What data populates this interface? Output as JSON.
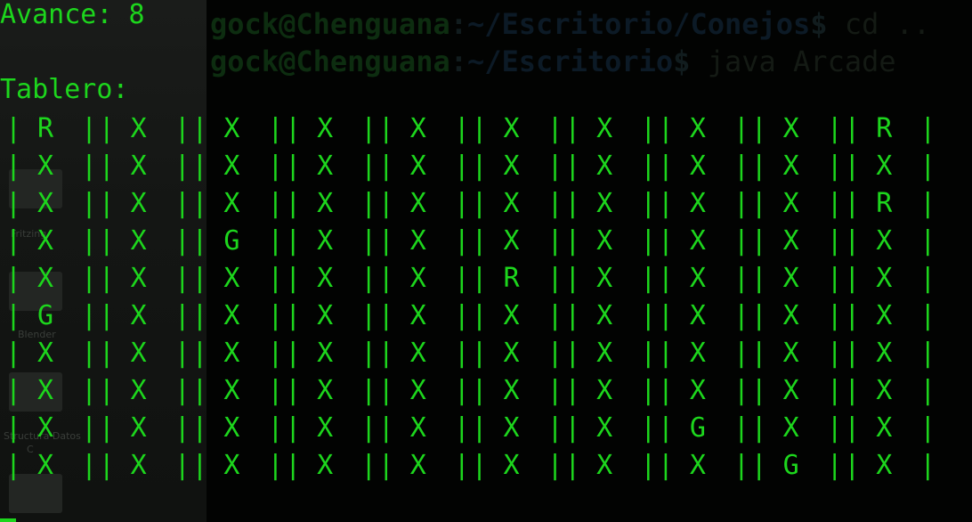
{
  "desktop": {
    "labels": [
      "Fritzing",
      "Blender",
      "Structura Datos",
      "C"
    ]
  },
  "background_terminal": {
    "line1": {
      "user": "gock@Chenguana",
      "sep": ":",
      "path": "~/Escritorio/Conejos",
      "prompt": "$",
      "cmd": " cd .."
    },
    "line2": {
      "user": "gock@Chenguana",
      "sep": ":",
      "path": "~/Escritorio",
      "prompt": "$",
      "cmd": " java Arcade"
    }
  },
  "terminal": {
    "avance_text": "Avance: 8",
    "tablero_text": "Tablero:",
    "separator": "|",
    "board": [
      [
        "R",
        "X",
        "X",
        "X",
        "X",
        "X",
        "X",
        "X",
        "X",
        "R"
      ],
      [
        "X",
        "X",
        "X",
        "X",
        "X",
        "X",
        "X",
        "X",
        "X",
        "X"
      ],
      [
        "X",
        "X",
        "X",
        "X",
        "X",
        "X",
        "X",
        "X",
        "X",
        "R"
      ],
      [
        "X",
        "X",
        "G",
        "X",
        "X",
        "X",
        "X",
        "X",
        "X",
        "X"
      ],
      [
        "X",
        "X",
        "X",
        "X",
        "X",
        "R",
        "X",
        "X",
        "X",
        "X"
      ],
      [
        "G",
        "X",
        "X",
        "X",
        "X",
        "X",
        "X",
        "X",
        "X",
        "X"
      ],
      [
        "X",
        "X",
        "X",
        "X",
        "X",
        "X",
        "X",
        "X",
        "X",
        "X"
      ],
      [
        "X",
        "X",
        "X",
        "X",
        "X",
        "X",
        "X",
        "X",
        "X",
        "X"
      ],
      [
        "X",
        "X",
        "X",
        "X",
        "X",
        "X",
        "X",
        "G",
        "X",
        "X"
      ],
      [
        "X",
        "X",
        "X",
        "X",
        "X",
        "X",
        "X",
        "X",
        "G",
        "X"
      ]
    ]
  }
}
